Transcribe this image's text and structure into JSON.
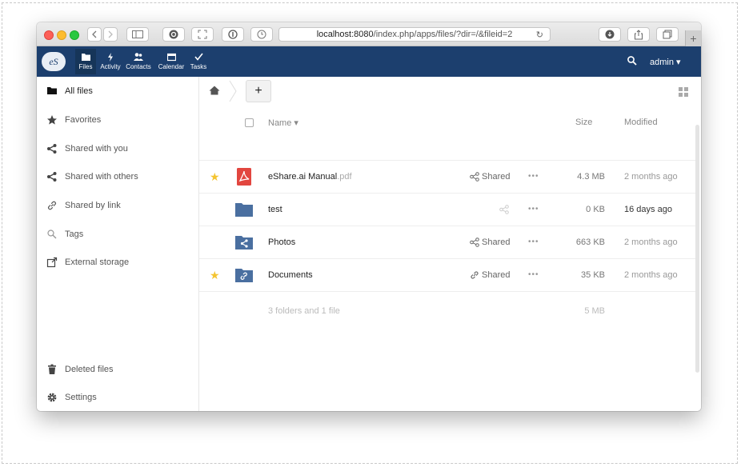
{
  "browser": {
    "url_host": "localhost:8080",
    "url_path": "/index.php/apps/files/?dir=/&fileid=2",
    "new_tab_label": "+"
  },
  "app": {
    "logo_text": "eS",
    "nav": [
      {
        "label": "Files",
        "icon": "folder-icon"
      },
      {
        "label": "Activity",
        "icon": "bolt-icon"
      },
      {
        "label": "Contacts",
        "icon": "users-icon"
      },
      {
        "label": "Calendar",
        "icon": "calendar-icon"
      },
      {
        "label": "Tasks",
        "icon": "check-icon"
      }
    ],
    "user": "admin ▾",
    "accent_color": "#1c3f6e"
  },
  "sidebar": {
    "items": [
      {
        "label": "All files",
        "icon": "folder-icon"
      },
      {
        "label": "Favorites",
        "icon": "star-icon"
      },
      {
        "label": "Shared with you",
        "icon": "share-icon"
      },
      {
        "label": "Shared with others",
        "icon": "share-icon"
      },
      {
        "label": "Shared by link",
        "icon": "link-icon"
      },
      {
        "label": "Tags",
        "icon": "tag-search-icon"
      },
      {
        "label": "External storage",
        "icon": "external-icon"
      }
    ],
    "bottom": [
      {
        "label": "Deleted files",
        "icon": "trash-icon"
      },
      {
        "label": "Settings",
        "icon": "gear-icon"
      }
    ]
  },
  "main": {
    "add_label": "+",
    "columns": {
      "name": "Name ▾",
      "size": "Size",
      "modified": "Modified"
    },
    "files": [
      {
        "name": "eShare.ai Manual",
        "ext": ".pdf",
        "favorite": true,
        "type": "pdf",
        "shared_label": "Shared",
        "share_type": "share",
        "size": "4.3 MB",
        "modified": "2 months ago",
        "recent": false
      },
      {
        "name": "test",
        "ext": "",
        "favorite": false,
        "type": "folder",
        "shared_label": "",
        "share_type": "none",
        "size": "0 KB",
        "modified": "16 days ago",
        "recent": true
      },
      {
        "name": "Photos",
        "ext": "",
        "favorite": false,
        "type": "folder-shared",
        "shared_label": "Shared",
        "share_type": "share",
        "size": "663 KB",
        "modified": "2 months ago",
        "recent": false
      },
      {
        "name": "Documents",
        "ext": "",
        "favorite": true,
        "type": "folder-link",
        "shared_label": "Shared",
        "share_type": "link",
        "size": "35 KB",
        "modified": "2 months ago",
        "recent": false
      }
    ],
    "summary": {
      "text": "3 folders and 1 file",
      "size": "5 MB"
    },
    "dots": "•••"
  }
}
